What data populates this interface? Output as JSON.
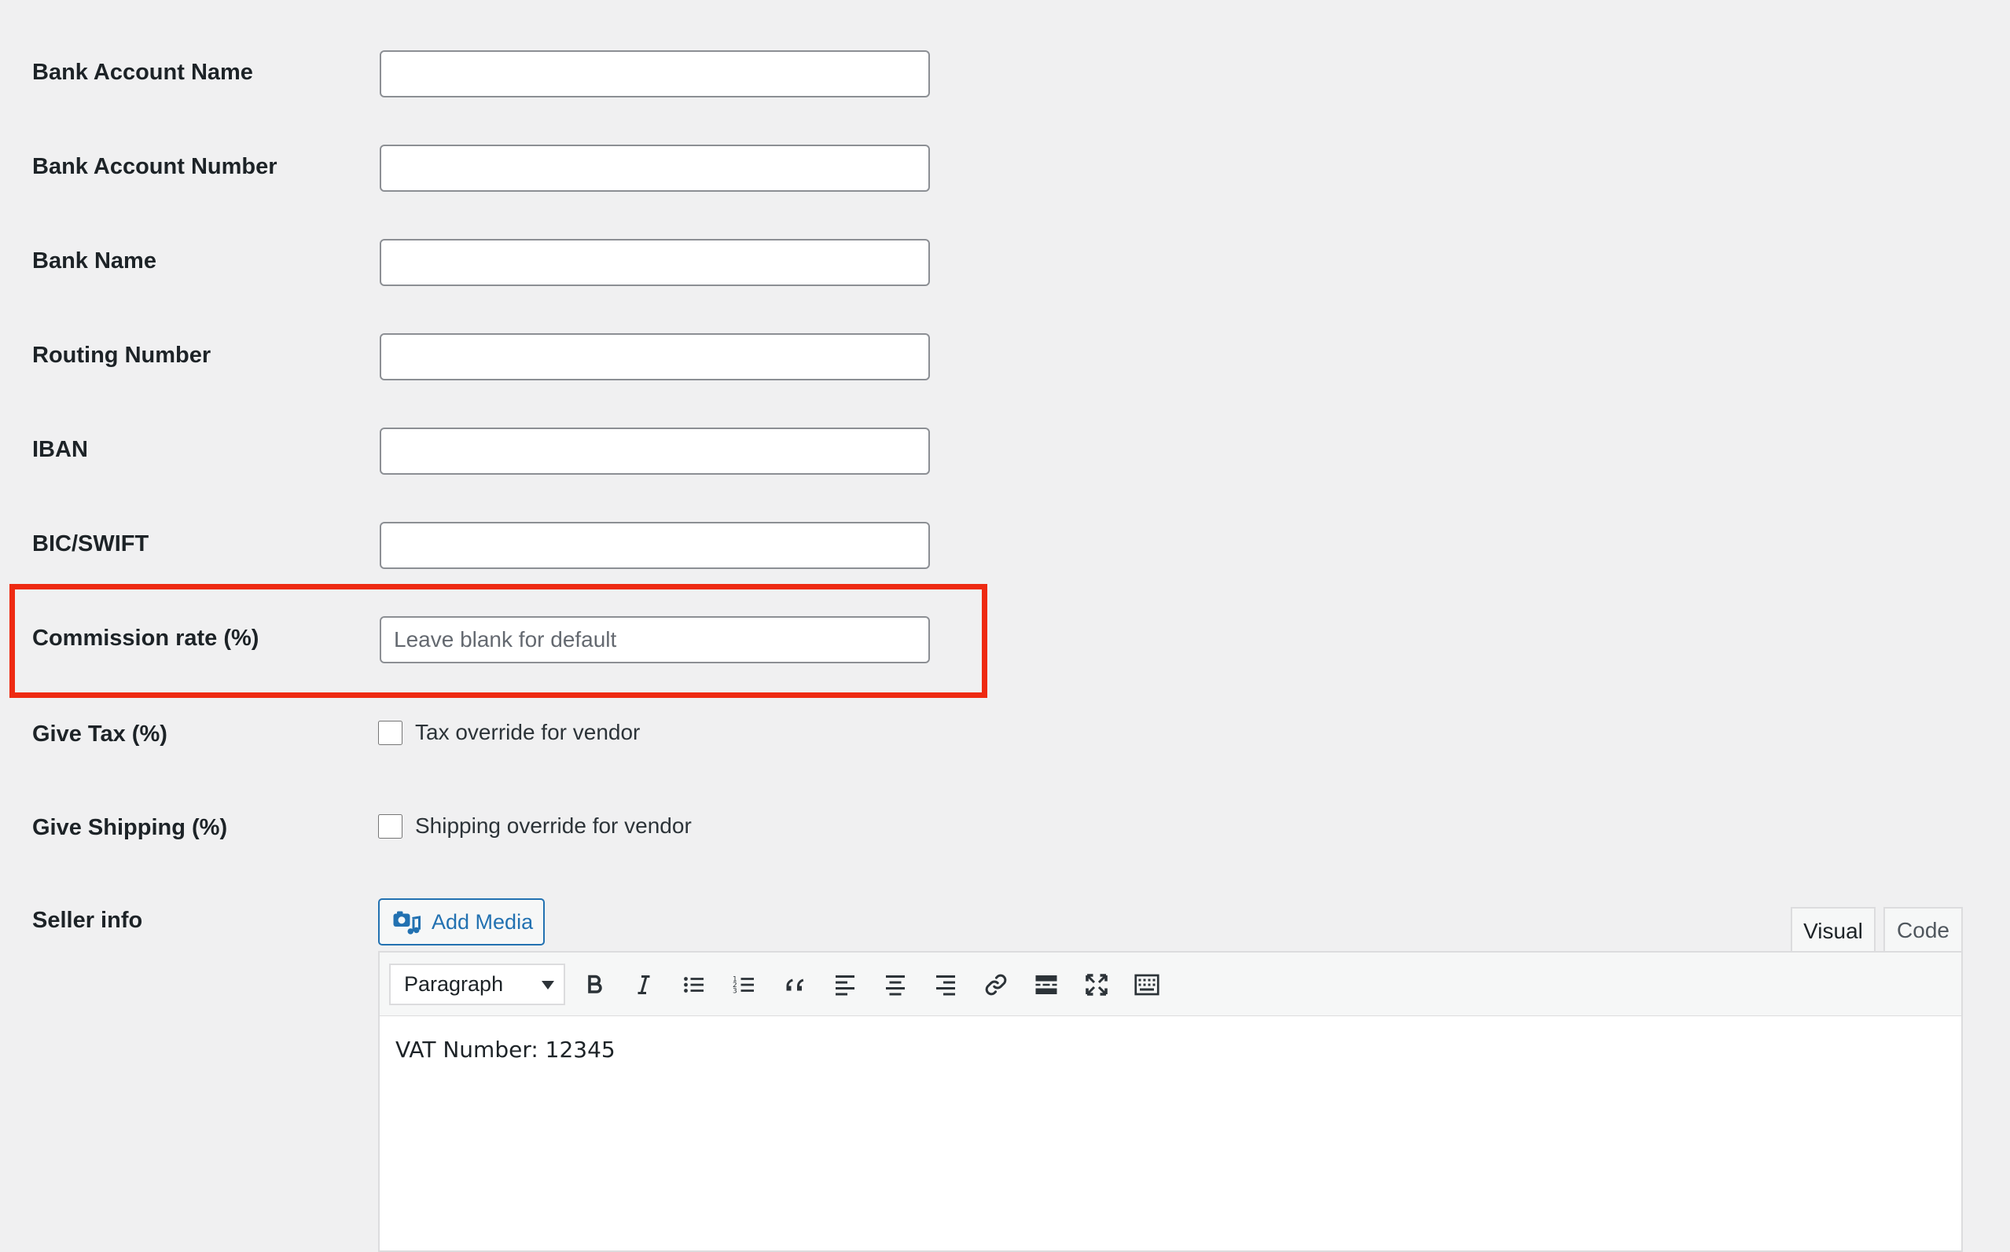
{
  "fields": [
    {
      "label": "Bank Account Name",
      "value": "",
      "placeholder": ""
    },
    {
      "label": "Bank Account Number",
      "value": "",
      "placeholder": ""
    },
    {
      "label": "Bank Name",
      "value": "",
      "placeholder": ""
    },
    {
      "label": "Routing Number",
      "value": "",
      "placeholder": ""
    },
    {
      "label": "IBAN",
      "value": "",
      "placeholder": ""
    },
    {
      "label": "BIC/SWIFT",
      "value": "",
      "placeholder": ""
    }
  ],
  "commission": {
    "label": "Commission rate (%)",
    "value": "",
    "placeholder": "Leave blank for default"
  },
  "give_tax": {
    "label": "Give Tax (%)",
    "checkbox_label": "Tax override for vendor",
    "checked": false
  },
  "give_shipping": {
    "label": "Give Shipping (%)",
    "checkbox_label": "Shipping override for vendor",
    "checked": false
  },
  "seller_info": {
    "label": "Seller info",
    "add_media_label": "Add Media",
    "tabs": [
      {
        "label": "Visual",
        "active": true
      },
      {
        "label": "Code",
        "active": false
      }
    ],
    "format_select": "Paragraph",
    "toolbar_icons": [
      "bold-icon",
      "italic-icon",
      "bulleted-list-icon",
      "numbered-list-icon",
      "blockquote-icon",
      "align-left-icon",
      "align-center-icon",
      "align-right-icon",
      "link-icon",
      "read-more-icon",
      "fullscreen-icon",
      "toolbar-toggle-icon"
    ],
    "content": "VAT Number: 12345"
  },
  "colors": {
    "highlight": "#ee2a12",
    "accent": "#2271b1",
    "background": "#f0f0f1"
  }
}
